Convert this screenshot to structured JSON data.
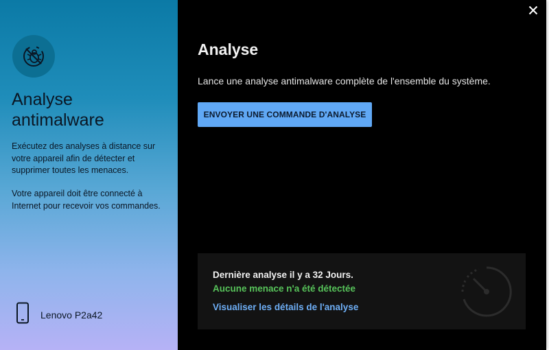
{
  "left": {
    "title": "Analyse antimalware",
    "description": "Exécutez des analyses à distance sur votre appareil afin de détecter et supprimer toutes les menaces.",
    "note": "Votre appareil doit être connecté à Internet pour recevoir vos commandes.",
    "device_name": "Lenovo P2a42",
    "feature_icon": "bug-scan-icon",
    "device_icon": "smartphone-icon"
  },
  "main": {
    "title": "Analyse",
    "description": "Lance une analyse antimalware complète de l'ensemble du système.",
    "scan_button_label": "ENVOYER UNE COMMANDE D'ANALYSE",
    "close_icon": "close-icon"
  },
  "status": {
    "last_scan": "Dernière analyse il y a 32 Jours.",
    "threat_status": "Aucune menace n'a été détectée",
    "details_link": "Visualiser les détails de l'analyse",
    "status_icon": "gauge-icon"
  },
  "colors": {
    "accent": "#60a8f5",
    "success": "#57c35a",
    "link": "#6eaef5",
    "background": "#000000"
  }
}
